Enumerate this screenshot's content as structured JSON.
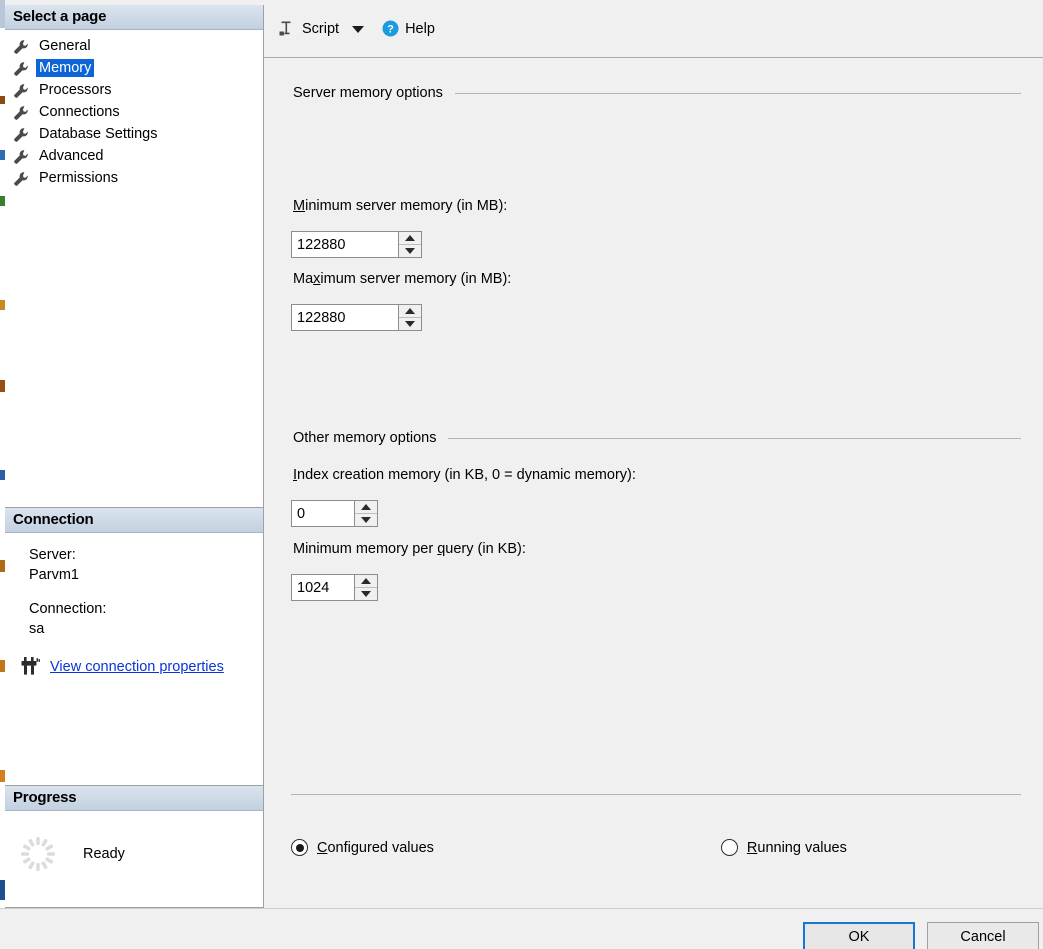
{
  "sidebar": {
    "select_page_header": "Select a page",
    "pages": [
      {
        "label": "General",
        "icon": "wrench-icon",
        "selected": false
      },
      {
        "label": "Memory",
        "icon": "wrench-icon",
        "selected": true
      },
      {
        "label": "Processors",
        "icon": "wrench-icon",
        "selected": false
      },
      {
        "label": "Connections",
        "icon": "wrench-icon",
        "selected": false
      },
      {
        "label": "Database Settings",
        "icon": "wrench-icon",
        "selected": false
      },
      {
        "label": "Advanced",
        "icon": "wrench-icon",
        "selected": false
      },
      {
        "label": "Permissions",
        "icon": "wrench-icon",
        "selected": false
      }
    ],
    "connection": {
      "header": "Connection",
      "server_label": "Server:",
      "server_value": "Parvm1",
      "connection_label": "Connection:",
      "connection_value": "sa",
      "link_text": "View connection properties",
      "link_icon": "plug-icon",
      "link_color": "#0a34d6"
    },
    "progress": {
      "header": "Progress",
      "status": "Ready",
      "icon": "spinner-icon"
    },
    "selection_color": "#0c64d6"
  },
  "toolbar": {
    "script_label": "Script",
    "script_icon": "script-icon",
    "dropdown_icon": "chevron-down-icon",
    "help_label": "Help",
    "help_icon": "help-circle-icon",
    "help_icon_color": "#1b9ae0"
  },
  "main": {
    "server_memory_group": {
      "title": "Server memory options",
      "min_label_prefix": "M",
      "min_label_rest": "inimum server memory (in MB):",
      "min_value": "122880",
      "max_label_a": "Ma",
      "max_label_accel": "x",
      "max_label_b": "imum server memory (in MB):",
      "max_value": "122880"
    },
    "other_memory_group": {
      "title": "Other memory options",
      "index_label_prefix": "I",
      "index_label_rest": "ndex creation memory (in KB, 0 = dynamic memory):",
      "index_value": "0",
      "minq_label_a": "Minimum memory per ",
      "minq_label_accel": "q",
      "minq_label_b": "uery (in KB):",
      "minq_value": "1024"
    },
    "values_radio": {
      "configured_accel": "C",
      "configured_rest": "onfigured values",
      "running_accel": "R",
      "running_rest": "unning values",
      "selected": "configured"
    }
  },
  "footer": {
    "ok_label": "OK",
    "cancel_label": "Cancel",
    "focus_color": "#1676d2"
  }
}
